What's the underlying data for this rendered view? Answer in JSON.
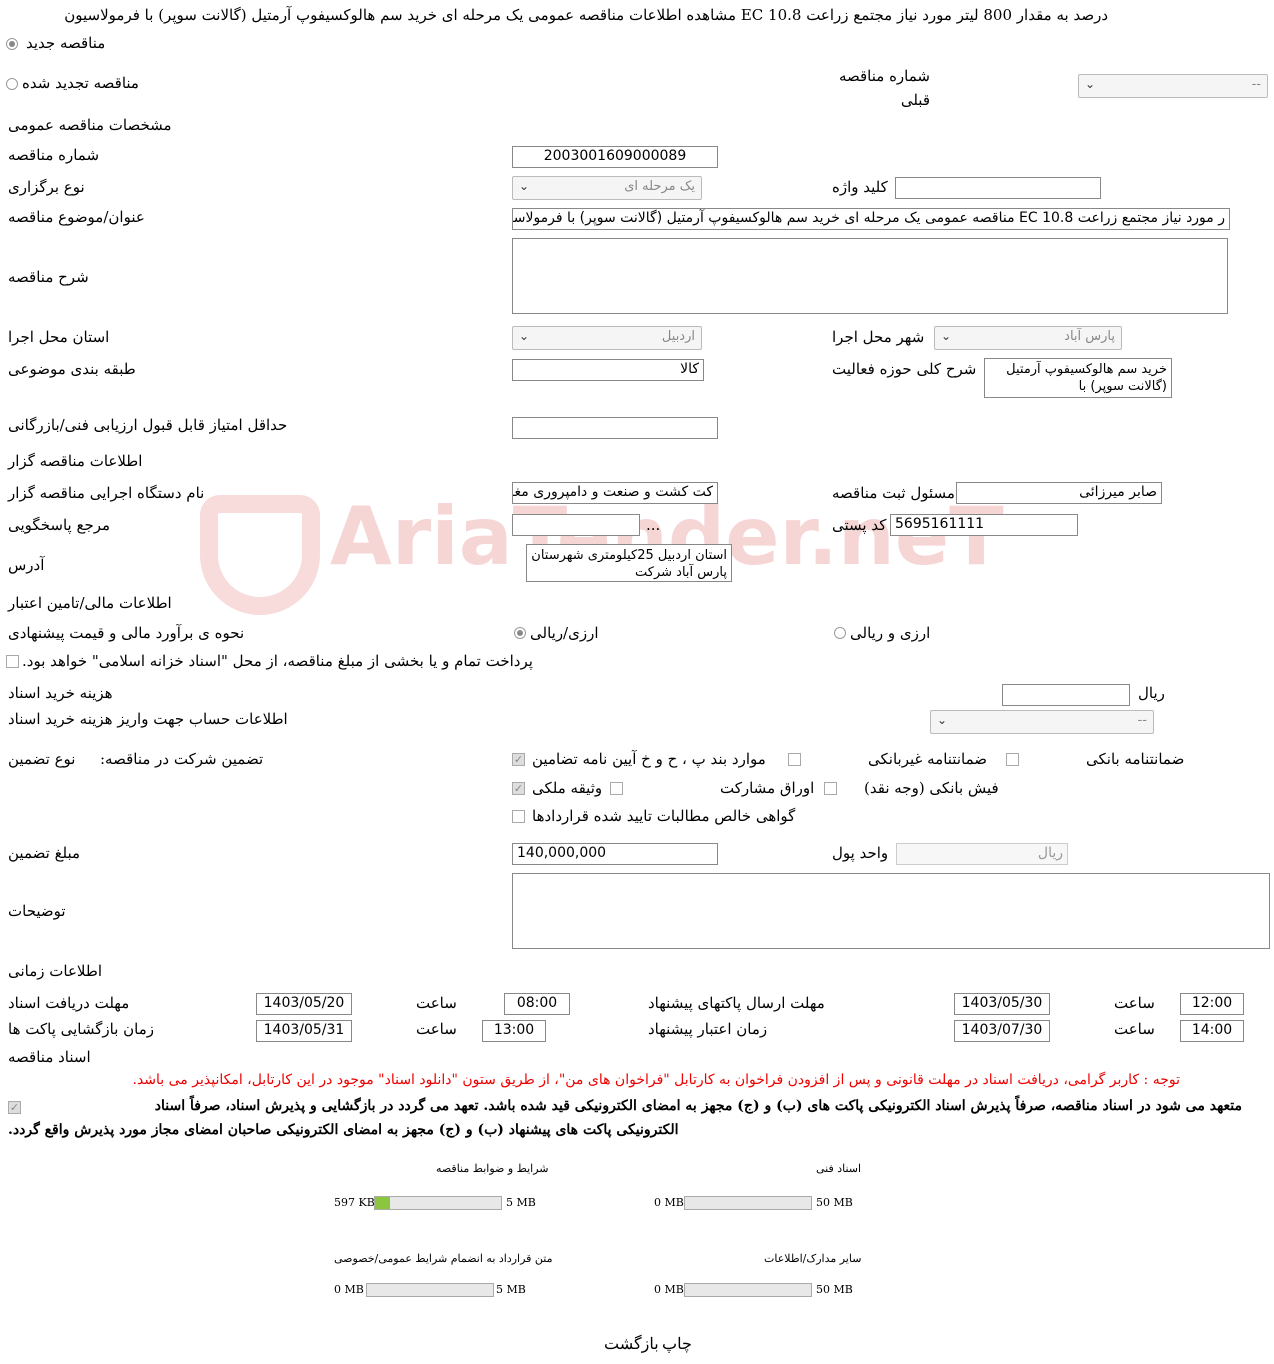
{
  "header": {
    "title": "درصد به مقدار 800 لیتر مورد نیاز مجتمع زراعت EC 10.8 مشاهده اطلاعات مناقصه عمومی یک مرحله ای خرید سم هالوکسیفوپ آرمتیل (گالانت سوپر) با فرمولاسیون",
    "new_tender": "مناقصه جدید",
    "renewed_tender": "مناقصه تجدید شده",
    "prev_number_label": "شماره مناقصه قبلی",
    "prev_number_value": "--"
  },
  "general": {
    "section": "مشخصات مناقصه عمومی",
    "number_label": "شماره مناقصه",
    "number_value": "2003001609000089",
    "type_label": "نوع برگزاری",
    "type_value": "یک مرحله ای",
    "keyword_label": "کلید واژه",
    "keyword_value": "",
    "subject_label": "عنوان/موضوع مناقصه",
    "subject_value": "ر مورد نیاز مجتمع زراعت EC  10.8 مناقصه عمومی یک مرحله ای خرید سم هالوکسیفوپ آرمتیل (گالانت سوپر) با فرمولاسیون",
    "desc_label": "شرح مناقصه",
    "province_label": "استان محل اجرا",
    "province_value": "اردبیل",
    "city_label": "شهر محل اجرا",
    "city_value": "پارس آباد",
    "category_label": "طبقه بندی موضوعی",
    "category_value": "کالا",
    "activity_label": "شرح کلی حوزه فعالیت",
    "activity_value": "خرید سم هالوکسیفوپ آرمتیل (گالانت سوپر) با",
    "min_score_label": "حداقل امتیاز قابل قبول ارزیابی فنی/بازرگانی"
  },
  "organizer": {
    "section": "اطلاعات مناقصه گزار",
    "org_label": "نام دستگاه اجرایی مناقصه گزار",
    "org_value": "کت کشت و صنعت و دامپروری مغان",
    "officer_label": "مسئول ثبت مناقصه",
    "officer_value": "صابر میرزائی",
    "ref_label": "مرجع پاسخگویی",
    "ref_dots": "...",
    "postal_label": "کد پستی",
    "postal_value": "5695161111",
    "address_label": "آدرس",
    "address_value": "استان اردبیل 25کیلومتری شهرستان پارس آباد شرکت"
  },
  "finance": {
    "section": "اطلاعات مالی/تامین اعتبار",
    "method_label": "نحوه ی برآورد مالی و قیمت پیشنهادی",
    "opt_currency_rial": "ارزی/ریالی",
    "opt_currency_and_rial": "ارزی و ریالی",
    "treasury_note": "پرداخت تمام و یا بخشی از مبلغ مناقصه، از محل \"اسناد خزانه اسلامی\" خواهد بود.",
    "doc_cost_label": "هزینه خرید اسناد",
    "doc_cost_unit": "ریال",
    "account_label": "اطلاعات حساب جهت واریز هزینه خرید اسناد",
    "account_value": "--"
  },
  "guarantee": {
    "label": "تضمین شرکت در مناقصه:",
    "type_label": "نوع تضمین",
    "bank": "ضمانتنامه بانکی",
    "nonbank": "ضمانتنامه غیربانکی",
    "items_bcd": "موارد بند پ ، ح و خ آیین نامه تضامین",
    "cash": "فیش بانکی (وجه نقد)",
    "bonds": "اوراق مشارکت",
    "property": "وثیقه ملکی",
    "receivables": "گواهی خالص مطالبات تایید شده قراردادها",
    "amount_label": "مبلغ تضمین",
    "amount_value": "140,000,000",
    "currency_label": "واحد پول",
    "currency_value": "ریال",
    "notes_label": "توضیحات"
  },
  "timing": {
    "section": "اطلاعات زمانی",
    "doc_deadline_label": "مهلت دریافت اسناد",
    "doc_deadline_date": "1403/05/20",
    "doc_deadline_time": "08:00",
    "submit_label": "مهلت ارسال پاکتهای پیشنهاد",
    "submit_date": "1403/05/30",
    "submit_time": "12:00",
    "open_label": "زمان بازگشایی پاکت ها",
    "open_date": "1403/05/31",
    "open_time": "13:00",
    "validity_label": "زمان اعتبار پیشنهاد",
    "validity_date": "1403/07/30",
    "validity_time": "14:00",
    "time_label": "ساعت"
  },
  "docs": {
    "section": "اسناد مناقصه",
    "notice": "توجه : کاربر گرامی، دریافت اسناد در مهلت قانونی و پس از افزودن فراخوان به کارتابل \"فراخوان های من\"، از طریق ستون \"دانلود اسناد\" موجود در این کارتابل، امکانپذیر می باشد.",
    "commit_line1": "متعهد می شود در اسناد مناقصه، صرفاً پذیرش اسناد الکترونیکی پاکت های (ب) و (ج) مجهز به امضای الکترونیکی قید شده باشد. تعهد می گردد در بازگشایی و پذیرش اسناد، صرفاً اسناد",
    "commit_line2": "الکترونیکی پاکت های پیشنهاد (ب) و (ج) مجهز به امضای الکترونیکی صاحبان امضای مجاز مورد پذیرش واقع گردد.",
    "files": [
      {
        "title": "شرایط و ضوابط مناقصه",
        "used": "597 KB",
        "max": "5 MB",
        "fraction": 0.12
      },
      {
        "title": "اسناد فنی",
        "used": "0 MB",
        "max": "50 MB",
        "fraction": 0
      },
      {
        "title": "متن قرارداد به انضمام شرایط عمومی/خصوصی",
        "used": "0 MB",
        "max": "5 MB",
        "fraction": 0
      },
      {
        "title": "سایر مدارک/اطلاعات",
        "used": "0 MB",
        "max": "50 MB",
        "fraction": 0
      }
    ]
  },
  "footer": {
    "print": "چاپ",
    "back": "بازگشت"
  },
  "watermark": "AriaTender.neT"
}
